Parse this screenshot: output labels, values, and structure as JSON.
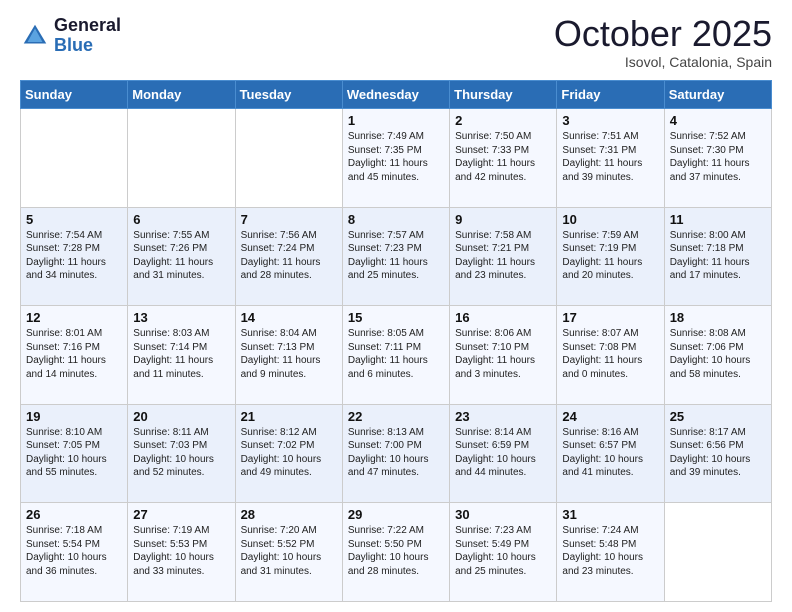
{
  "header": {
    "logo_line1": "General",
    "logo_line2": "Blue",
    "month": "October 2025",
    "location": "Isovol, Catalonia, Spain"
  },
  "weekdays": [
    "Sunday",
    "Monday",
    "Tuesday",
    "Wednesday",
    "Thursday",
    "Friday",
    "Saturday"
  ],
  "weeks": [
    [
      {
        "day": "",
        "text": ""
      },
      {
        "day": "",
        "text": ""
      },
      {
        "day": "",
        "text": ""
      },
      {
        "day": "1",
        "text": "Sunrise: 7:49 AM\nSunset: 7:35 PM\nDaylight: 11 hours\nand 45 minutes."
      },
      {
        "day": "2",
        "text": "Sunrise: 7:50 AM\nSunset: 7:33 PM\nDaylight: 11 hours\nand 42 minutes."
      },
      {
        "day": "3",
        "text": "Sunrise: 7:51 AM\nSunset: 7:31 PM\nDaylight: 11 hours\nand 39 minutes."
      },
      {
        "day": "4",
        "text": "Sunrise: 7:52 AM\nSunset: 7:30 PM\nDaylight: 11 hours\nand 37 minutes."
      }
    ],
    [
      {
        "day": "5",
        "text": "Sunrise: 7:54 AM\nSunset: 7:28 PM\nDaylight: 11 hours\nand 34 minutes."
      },
      {
        "day": "6",
        "text": "Sunrise: 7:55 AM\nSunset: 7:26 PM\nDaylight: 11 hours\nand 31 minutes."
      },
      {
        "day": "7",
        "text": "Sunrise: 7:56 AM\nSunset: 7:24 PM\nDaylight: 11 hours\nand 28 minutes."
      },
      {
        "day": "8",
        "text": "Sunrise: 7:57 AM\nSunset: 7:23 PM\nDaylight: 11 hours\nand 25 minutes."
      },
      {
        "day": "9",
        "text": "Sunrise: 7:58 AM\nSunset: 7:21 PM\nDaylight: 11 hours\nand 23 minutes."
      },
      {
        "day": "10",
        "text": "Sunrise: 7:59 AM\nSunset: 7:19 PM\nDaylight: 11 hours\nand 20 minutes."
      },
      {
        "day": "11",
        "text": "Sunrise: 8:00 AM\nSunset: 7:18 PM\nDaylight: 11 hours\nand 17 minutes."
      }
    ],
    [
      {
        "day": "12",
        "text": "Sunrise: 8:01 AM\nSunset: 7:16 PM\nDaylight: 11 hours\nand 14 minutes."
      },
      {
        "day": "13",
        "text": "Sunrise: 8:03 AM\nSunset: 7:14 PM\nDaylight: 11 hours\nand 11 minutes."
      },
      {
        "day": "14",
        "text": "Sunrise: 8:04 AM\nSunset: 7:13 PM\nDaylight: 11 hours\nand 9 minutes."
      },
      {
        "day": "15",
        "text": "Sunrise: 8:05 AM\nSunset: 7:11 PM\nDaylight: 11 hours\nand 6 minutes."
      },
      {
        "day": "16",
        "text": "Sunrise: 8:06 AM\nSunset: 7:10 PM\nDaylight: 11 hours\nand 3 minutes."
      },
      {
        "day": "17",
        "text": "Sunrise: 8:07 AM\nSunset: 7:08 PM\nDaylight: 11 hours\nand 0 minutes."
      },
      {
        "day": "18",
        "text": "Sunrise: 8:08 AM\nSunset: 7:06 PM\nDaylight: 10 hours\nand 58 minutes."
      }
    ],
    [
      {
        "day": "19",
        "text": "Sunrise: 8:10 AM\nSunset: 7:05 PM\nDaylight: 10 hours\nand 55 minutes."
      },
      {
        "day": "20",
        "text": "Sunrise: 8:11 AM\nSunset: 7:03 PM\nDaylight: 10 hours\nand 52 minutes."
      },
      {
        "day": "21",
        "text": "Sunrise: 8:12 AM\nSunset: 7:02 PM\nDaylight: 10 hours\nand 49 minutes."
      },
      {
        "day": "22",
        "text": "Sunrise: 8:13 AM\nSunset: 7:00 PM\nDaylight: 10 hours\nand 47 minutes."
      },
      {
        "day": "23",
        "text": "Sunrise: 8:14 AM\nSunset: 6:59 PM\nDaylight: 10 hours\nand 44 minutes."
      },
      {
        "day": "24",
        "text": "Sunrise: 8:16 AM\nSunset: 6:57 PM\nDaylight: 10 hours\nand 41 minutes."
      },
      {
        "day": "25",
        "text": "Sunrise: 8:17 AM\nSunset: 6:56 PM\nDaylight: 10 hours\nand 39 minutes."
      }
    ],
    [
      {
        "day": "26",
        "text": "Sunrise: 7:18 AM\nSunset: 5:54 PM\nDaylight: 10 hours\nand 36 minutes."
      },
      {
        "day": "27",
        "text": "Sunrise: 7:19 AM\nSunset: 5:53 PM\nDaylight: 10 hours\nand 33 minutes."
      },
      {
        "day": "28",
        "text": "Sunrise: 7:20 AM\nSunset: 5:52 PM\nDaylight: 10 hours\nand 31 minutes."
      },
      {
        "day": "29",
        "text": "Sunrise: 7:22 AM\nSunset: 5:50 PM\nDaylight: 10 hours\nand 28 minutes."
      },
      {
        "day": "30",
        "text": "Sunrise: 7:23 AM\nSunset: 5:49 PM\nDaylight: 10 hours\nand 25 minutes."
      },
      {
        "day": "31",
        "text": "Sunrise: 7:24 AM\nSunset: 5:48 PM\nDaylight: 10 hours\nand 23 minutes."
      },
      {
        "day": "",
        "text": ""
      }
    ]
  ]
}
